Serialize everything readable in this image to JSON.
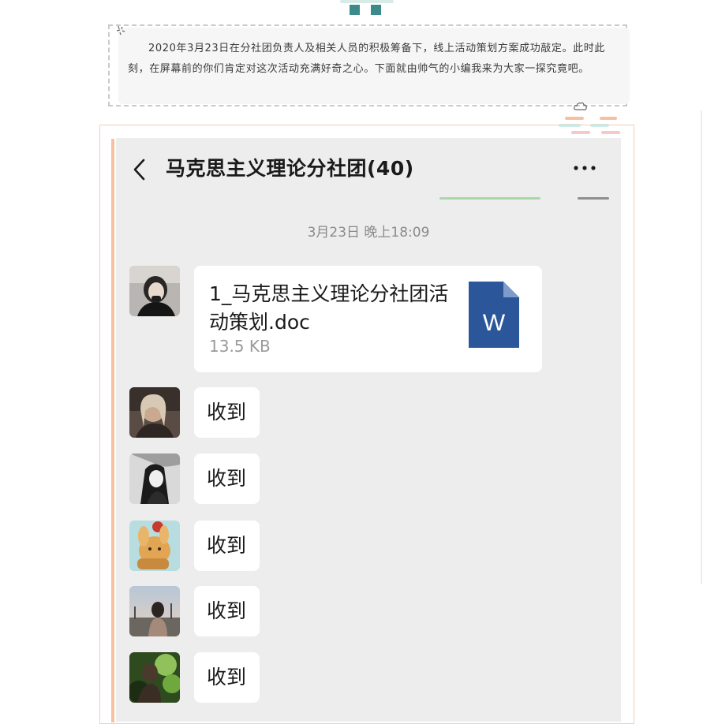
{
  "intro": {
    "text": "2020年3月23日在分社团负责人及相关人员的积极筹备下，线上活动策划方案成功敲定。此时此刻，在屏幕前的你们肯定对这次活动充满好奇之心。下面就由帅气的小编我来为大家一探究竟吧。"
  },
  "chat": {
    "title": "马克思主义理论分社团(40)",
    "timestamp": "3月23日 晚上18:09",
    "file": {
      "name": "1_马克思主义理论分社团活动策划.doc",
      "size": "13.5 KB",
      "icon_letter": "W"
    },
    "messages": [
      {
        "text": "收到"
      },
      {
        "text": "收到"
      },
      {
        "text": "收到"
      },
      {
        "text": "收到"
      },
      {
        "text": "收到"
      }
    ]
  },
  "colors": {
    "accent_teal": "#3c8b8a",
    "frame_peach": "#f7c1a0",
    "word_blue": "#2b579a",
    "chat_bg": "#ededed"
  }
}
